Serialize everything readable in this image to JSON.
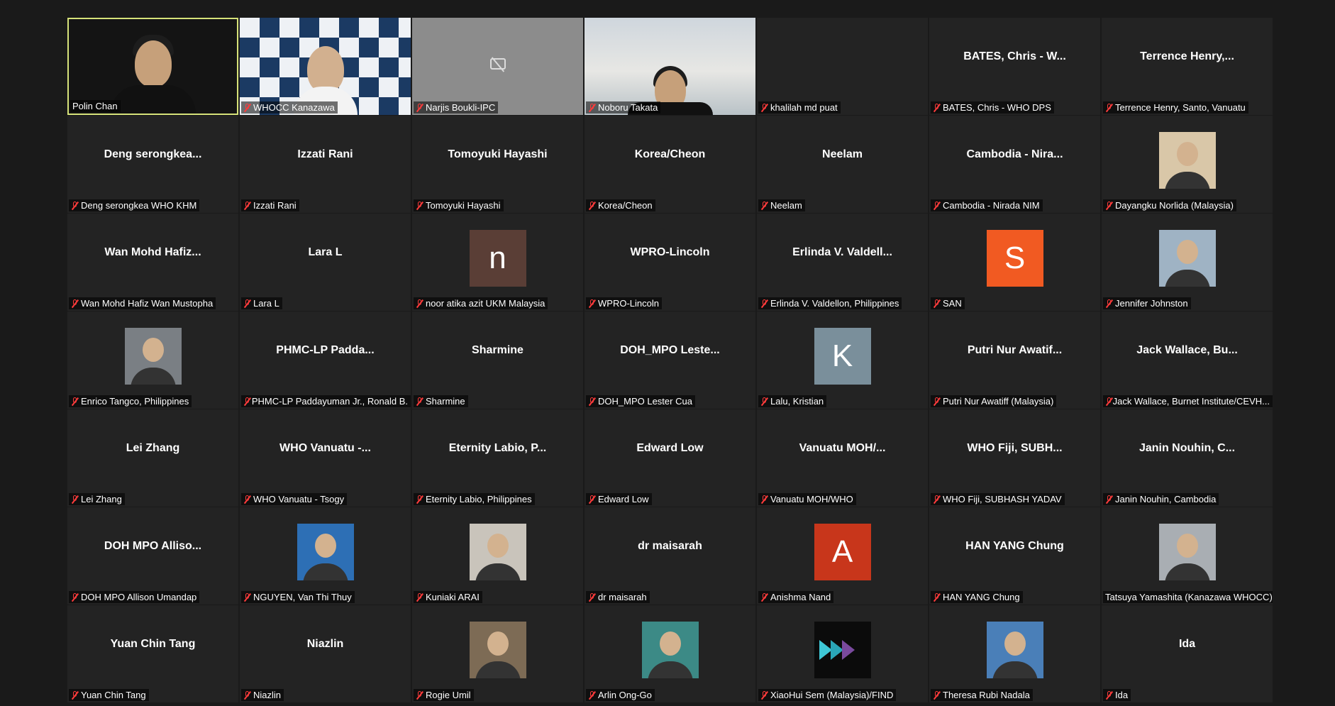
{
  "participants": [
    {
      "display": "",
      "label": "Polin Chan",
      "muted": false,
      "active": true,
      "kind": "video"
    },
    {
      "display": "",
      "label": "WHOCC Kanazawa",
      "muted": true,
      "kind": "video-checker"
    },
    {
      "display": "",
      "label": "Narjis Boukli-IPC",
      "muted": true,
      "kind": "camera-off"
    },
    {
      "display": "",
      "label": "Noboru Takata",
      "muted": true,
      "kind": "video-office"
    },
    {
      "display": "",
      "label": "khalilah md puat",
      "muted": true,
      "kind": "blank"
    },
    {
      "display": "BATES, Chris - W...",
      "label": "BATES, Chris - WHO DPS",
      "muted": true,
      "kind": "name"
    },
    {
      "display": "Terrence Henry,...",
      "label": "Terrence Henry, Santo, Vanuatu",
      "muted": true,
      "kind": "name"
    },
    {
      "display": "Deng serongkea...",
      "label": "Deng serongkea WHO KHM",
      "muted": true,
      "kind": "name"
    },
    {
      "display": "Izzati Rani",
      "label": "Izzati Rani",
      "muted": true,
      "kind": "name"
    },
    {
      "display": "Tomoyuki Hayashi",
      "label": "Tomoyuki Hayashi",
      "muted": true,
      "kind": "name"
    },
    {
      "display": "Korea/Cheon",
      "label": "Korea/Cheon",
      "muted": true,
      "kind": "name"
    },
    {
      "display": "Neelam",
      "label": "Neelam",
      "muted": true,
      "kind": "name"
    },
    {
      "display": "Cambodia - Nira...",
      "label": "Cambodia - Nirada NIM",
      "muted": true,
      "kind": "name"
    },
    {
      "display": "",
      "label": "Dayangku Norlida (Malaysia)",
      "muted": true,
      "kind": "photo",
      "color": "#d9c7a8"
    },
    {
      "display": "Wan Mohd Hafiz...",
      "label": "Wan Mohd Hafiz Wan Mustopha",
      "muted": true,
      "kind": "name"
    },
    {
      "display": "Lara L",
      "label": "Lara L",
      "muted": true,
      "kind": "name"
    },
    {
      "display": "",
      "label": "noor atika azit UKM Malaysia",
      "muted": true,
      "kind": "letter",
      "letter": "n",
      "color": "#5a3e36"
    },
    {
      "display": "WPRO-Lincoln",
      "label": "WPRO-Lincoln",
      "muted": true,
      "kind": "name"
    },
    {
      "display": "Erlinda V. Valdell...",
      "label": "Erlinda V. Valdellon, Philippines",
      "muted": true,
      "kind": "name"
    },
    {
      "display": "",
      "label": "SAN",
      "muted": true,
      "kind": "letter",
      "letter": "S",
      "color": "#f15a22"
    },
    {
      "display": "",
      "label": "Jennifer Johnston",
      "muted": true,
      "kind": "photo",
      "color": "#9fb3c4"
    },
    {
      "display": "",
      "label": "Enrico Tangco, Philippines",
      "muted": true,
      "kind": "photo",
      "color": "#7a7f84"
    },
    {
      "display": "PHMC-LP Padda...",
      "label": "PHMC-LP Paddayuman Jr., Ronald B.",
      "muted": true,
      "kind": "name"
    },
    {
      "display": "Sharmine",
      "label": "Sharmine",
      "muted": true,
      "kind": "name"
    },
    {
      "display": "DOH_MPO Leste...",
      "label": "DOH_MPO Lester Cua",
      "muted": true,
      "kind": "name"
    },
    {
      "display": "",
      "label": "Lalu, Kristian",
      "muted": true,
      "kind": "letter",
      "letter": "K",
      "color": "#7a8f9b"
    },
    {
      "display": "Putri Nur Awatif...",
      "label": "Putri Nur Awatiff (Malaysia)",
      "muted": true,
      "kind": "name"
    },
    {
      "display": "Jack Wallace, Bu...",
      "label": "Jack Wallace, Burnet Institute/CEVH...",
      "muted": true,
      "kind": "name"
    },
    {
      "display": "Lei Zhang",
      "label": "Lei Zhang",
      "muted": true,
      "kind": "name"
    },
    {
      "display": "WHO Vanuatu -...",
      "label": "WHO Vanuatu - Tsogy",
      "muted": true,
      "kind": "name"
    },
    {
      "display": "Eternity Labio, P...",
      "label": "Eternity Labio, Philippines",
      "muted": true,
      "kind": "name"
    },
    {
      "display": "Edward Low",
      "label": "Edward Low",
      "muted": true,
      "kind": "name"
    },
    {
      "display": "Vanuatu MOH/...",
      "label": "Vanuatu MOH/WHO",
      "muted": true,
      "kind": "name"
    },
    {
      "display": "WHO Fiji, SUBH...",
      "label": "WHO Fiji, SUBHASH YADAV",
      "muted": true,
      "kind": "name"
    },
    {
      "display": "Janin Nouhin, C...",
      "label": "Janin Nouhin, Cambodia",
      "muted": true,
      "kind": "name"
    },
    {
      "display": "DOH MPO Alliso...",
      "label": "DOH MPO Allison Umandap",
      "muted": true,
      "kind": "name"
    },
    {
      "display": "",
      "label": "NGUYEN, Van Thi Thuy",
      "muted": true,
      "kind": "photo",
      "color": "#2d6fb5"
    },
    {
      "display": "",
      "label": "Kuniaki ARAI",
      "muted": true,
      "kind": "photo",
      "color": "#c9c4bb"
    },
    {
      "display": "dr maisarah",
      "label": "dr maisarah",
      "muted": true,
      "kind": "name"
    },
    {
      "display": "",
      "label": "Anishma Nand",
      "muted": true,
      "kind": "letter",
      "letter": "A",
      "color": "#c8361b"
    },
    {
      "display": "HAN YANG Chung",
      "label": "HAN YANG Chung",
      "muted": true,
      "kind": "name"
    },
    {
      "display": "",
      "label": "Tatsuya Yamashita (Kanazawa WHOCC)",
      "muted": false,
      "kind": "photo",
      "color": "#a9aeb3"
    },
    {
      "display": "Yuan Chin Tang",
      "label": "Yuan Chin Tang",
      "muted": true,
      "kind": "name"
    },
    {
      "display": "Niazlin",
      "label": "Niazlin",
      "muted": true,
      "kind": "name"
    },
    {
      "display": "",
      "label": "Rogie Umil",
      "muted": true,
      "kind": "photo",
      "color": "#7d6b55"
    },
    {
      "display": "",
      "label": "Arlin Ong-Go",
      "muted": true,
      "kind": "photo",
      "color": "#3c8a86"
    },
    {
      "display": "",
      "label": "XiaoHui Sem (Malaysia)/FIND",
      "muted": true,
      "kind": "logo",
      "color": "#0b0b0b"
    },
    {
      "display": "",
      "label": "Theresa Rubi Nadala",
      "muted": true,
      "kind": "photo",
      "color": "#4a7fb8"
    },
    {
      "display": "Ida",
      "label": "Ida",
      "muted": true,
      "kind": "name"
    }
  ]
}
